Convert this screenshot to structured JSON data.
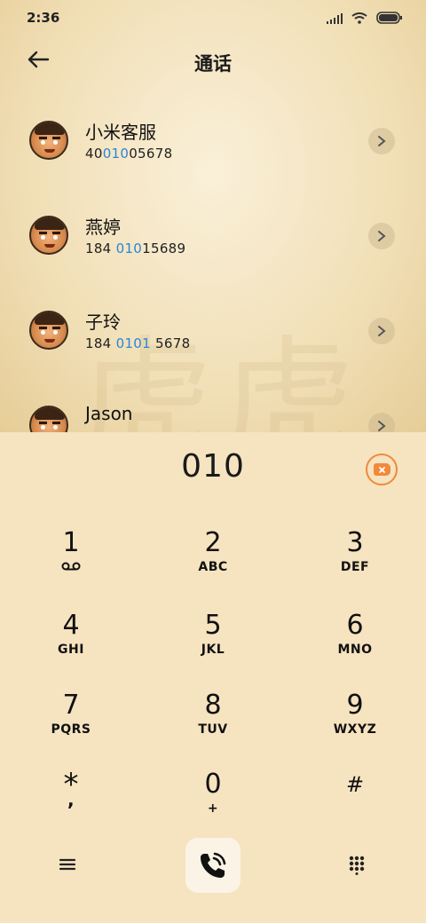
{
  "status_bar": {
    "time": "2:36",
    "icons": [
      "signal-icon",
      "wifi-icon",
      "battery-icon"
    ]
  },
  "header": {
    "title": "通话",
    "back_icon": "back-arrow-icon"
  },
  "watermark_text": "虎虎",
  "contacts": [
    {
      "name": "小米客服",
      "number_pre": "40",
      "number_match": "010",
      "number_post": "05678"
    },
    {
      "name": "燕婷",
      "number_pre": "184 ",
      "number_match": "010",
      "number_post": "15689"
    },
    {
      "name": "子玲",
      "number_pre": "184 ",
      "number_match": "0101",
      "number_post": " 5678"
    },
    {
      "name": "Jason",
      "number_pre": "",
      "number_match": "",
      "number_post": ""
    }
  ],
  "dialer": {
    "display": "010",
    "backspace_icon": "backspace-icon",
    "keys": [
      {
        "digit": "1",
        "letters": ""
      },
      {
        "digit": "2",
        "letters": "ABC"
      },
      {
        "digit": "3",
        "letters": "DEF"
      },
      {
        "digit": "4",
        "letters": "GHI"
      },
      {
        "digit": "5",
        "letters": "JKL"
      },
      {
        "digit": "6",
        "letters": "MNO"
      },
      {
        "digit": "7",
        "letters": "PQRS"
      },
      {
        "digit": "8",
        "letters": "TUV"
      },
      {
        "digit": "9",
        "letters": "WXYZ"
      },
      {
        "digit": "*",
        "letters": ","
      },
      {
        "digit": "0",
        "letters": "+"
      },
      {
        "digit": "#",
        "letters": ""
      }
    ]
  },
  "bottom_bar": {
    "menu_icon": "menu-icon",
    "call_icon": "phone-call-icon",
    "keypad_icon": "keypad-grid-icon"
  },
  "colors": {
    "highlight": "#2a86d8",
    "accent": "#f08a3a",
    "dialer_bg": "#f6e3c0"
  }
}
